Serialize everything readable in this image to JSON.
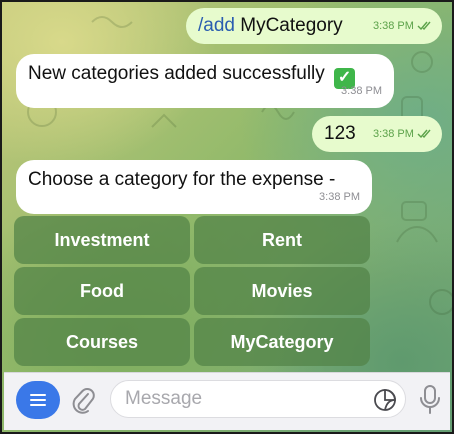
{
  "messages": [
    {
      "direction": "out",
      "command": "/add",
      "text": " MyCategory",
      "time": "3:38 PM",
      "status": "read"
    },
    {
      "direction": "in",
      "text": "New categories added successfully",
      "emoji": "white-check-mark",
      "time": "3:38 PM"
    },
    {
      "direction": "out",
      "text": "123",
      "time": "3:38 PM",
      "status": "read"
    },
    {
      "direction": "in",
      "text": "Choose a category for the expense -",
      "time": "3:38 PM"
    }
  ],
  "keyboard": {
    "buttons": [
      "Investment",
      "Rent",
      "Food",
      "Movies",
      "Courses",
      "MyCategory"
    ]
  },
  "input": {
    "placeholder": "Message",
    "value": ""
  },
  "icons": {
    "menu": "menu-icon",
    "attach": "paperclip-icon",
    "sticker": "sticker-icon",
    "mic": "microphone-icon",
    "read": "double-check-icon"
  },
  "colors": {
    "outgoing_bubble": "#e7fbcd",
    "incoming_bubble": "#ffffff",
    "accent": "#3a78e8",
    "keyboard_button": "#528246"
  }
}
